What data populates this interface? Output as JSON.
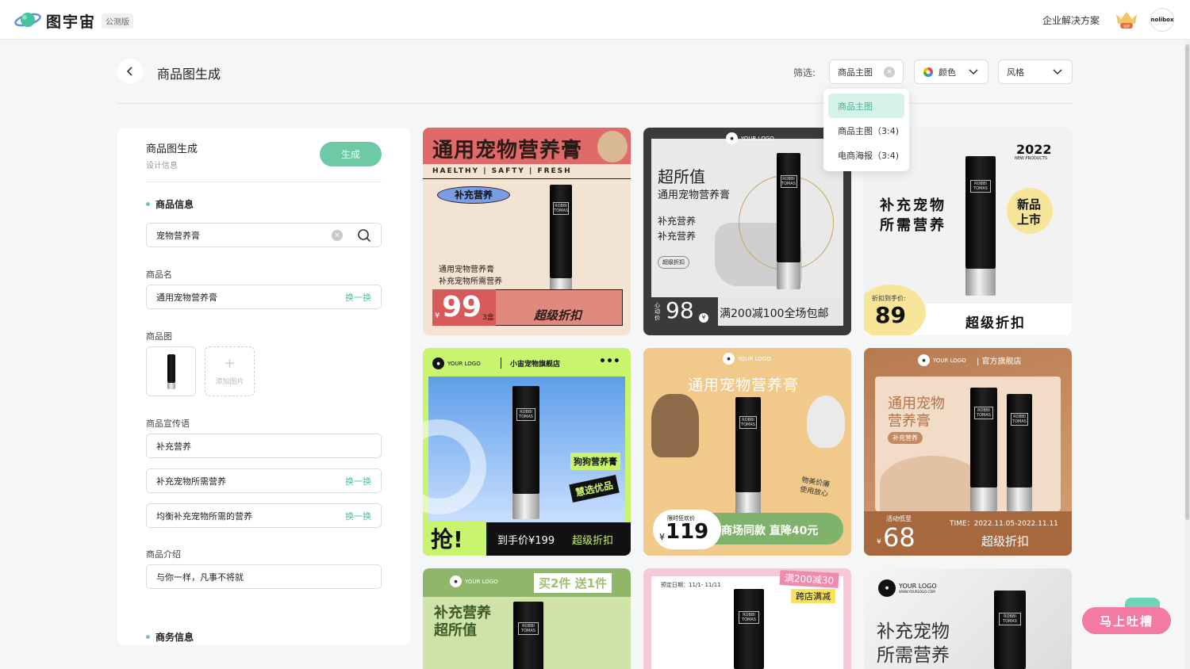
{
  "app": {
    "name": "图宇宙",
    "edition": "公测版",
    "enterprise": "企业解决方案",
    "vip": "VIP",
    "user_badge": "nolibox"
  },
  "header": {
    "title": "商品图生成",
    "filter_label": "筛选:",
    "filter_type": "商品主图",
    "filter_color": "颜色",
    "filter_style": "风格"
  },
  "dropdown": {
    "items": [
      "商品主图",
      "商品主图（3:4)",
      "电商海报（3:4)"
    ]
  },
  "panel": {
    "title": "商品图生成",
    "subtitle": "设计信息",
    "generate": "生成",
    "section_product": "商品信息",
    "search_value": "宠物营养膏",
    "name_label": "商品名",
    "name_value": "通用宠物营养膏",
    "swap": "换一换",
    "image_label": "商品图",
    "add_image": "添加图片",
    "slogan_label": "商品宣传语",
    "slogans": [
      "补充营养",
      "补充宠物所需营养",
      "均衡补充宠物所需的营养"
    ],
    "intro_label": "商品介绍",
    "intro_value": "与你一样，凡事不将就",
    "section_business": "商务信息"
  },
  "cards": {
    "c1": {
      "title": "通用宠物营养膏",
      "tagline": "HAELTHY | SAFTY | FRESH",
      "badge": "补充营养",
      "line1": "通用宠物营养膏",
      "line2": "补充宠物所需营养",
      "currency": "¥",
      "price": "99",
      "unit": "3盒",
      "promo": "超级折扣"
    },
    "c2": {
      "logo": "YOUR LOGO",
      "title": "超所值",
      "subtitle": "通用宠物营养膏",
      "line1": "补充营养",
      "line2": "补充营养",
      "tag": "超级折扣",
      "heart": "心动价",
      "price": "98",
      "currency": "¥",
      "promo": "满200减100全场包邮"
    },
    "c3": {
      "year": "2022",
      "year_sub": "NEW PRODUCTS",
      "title1": "补充宠物",
      "title2": "所需营养",
      "badge1": "新品",
      "badge2": "上市",
      "pre": "折扣到手价:",
      "price": "89",
      "promo": "超级折扣"
    },
    "c4": {
      "logo": "YOUR LOGO",
      "store": "小宙宠物旗舰店",
      "tag1": "狗狗营养膏",
      "tag2": "慧选优品",
      "grab": "抢!",
      "price": "到手价¥199",
      "promo": "超级折扣"
    },
    "c5": {
      "logo": "YOUR LOGO",
      "title": "通用宠物营养膏",
      "note1": "物美价廉",
      "note2": "使用放心",
      "limited": "限时狂欢价",
      "currency": "¥",
      "price": "119",
      "promo": "商场同款 直降40元"
    },
    "c6": {
      "logo": "YOUR LOGO",
      "store": "| 官方旗舰店",
      "title1": "通用宠物",
      "title2": "营养膏",
      "tag": "补充营养",
      "low": "活动低至",
      "currency": "¥",
      "price": "68",
      "time": "TIME：2022.11.05-2022.11.11",
      "promo": "超级折扣"
    },
    "c7": {
      "logo": "YOUR LOGO",
      "offer": "买2件 送1件",
      "title1": "补充营养",
      "title2": "超所值"
    },
    "c8": {
      "presale": "预定日期：11/1- 11/11",
      "offer1": "满200减30",
      "offer2": "跨店满减"
    },
    "c9": {
      "logo": "YOUR LOGO",
      "site": "WWW.YOURLOGO.COM",
      "title1": "补充宠物",
      "title2": "所需营养"
    },
    "product_brand": "ROBBI TOMAS"
  },
  "feedback": "马上吐槽",
  "colors": {
    "accent": "#6ec9a7",
    "link": "#4fbd96"
  }
}
